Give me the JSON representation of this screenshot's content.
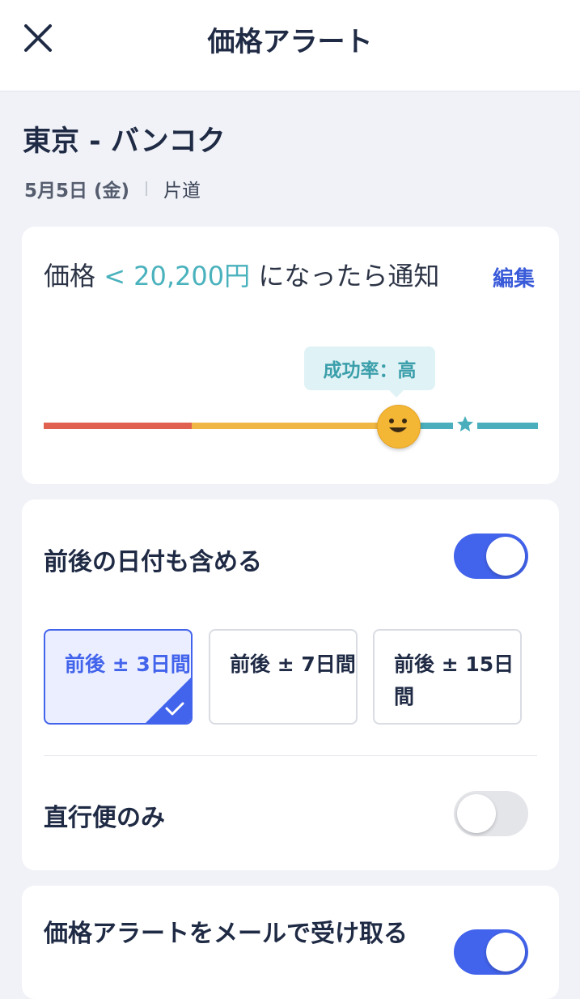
{
  "header": {
    "title": "価格アラート",
    "close_icon": "close-icon"
  },
  "route": {
    "title": "東京 - バンコク",
    "date": "5月5日 (金)",
    "trip_type": "片道"
  },
  "alert": {
    "prefix": "価格",
    "price": "< 20,200円",
    "suffix": "になったら通知",
    "edit_label": "編集",
    "success_label": "成功率：高",
    "slider_position_percent": 71
  },
  "flex_dates": {
    "label": "前後の日付も含める",
    "enabled": true,
    "options": [
      {
        "label": "前後 ± 3日間",
        "selected": true
      },
      {
        "label": "前後 ± 7日間",
        "selected": false
      },
      {
        "label": "前後 ± 15日間",
        "selected": false
      }
    ]
  },
  "direct_only": {
    "label": "直行便のみ",
    "enabled": false
  },
  "email_alert": {
    "label": "価格アラートをメールで受け取る",
    "enabled": true
  },
  "colors": {
    "accent": "#4263eb",
    "teal": "#4aaebc",
    "red": "#e0614f",
    "yellow": "#f0b744"
  }
}
